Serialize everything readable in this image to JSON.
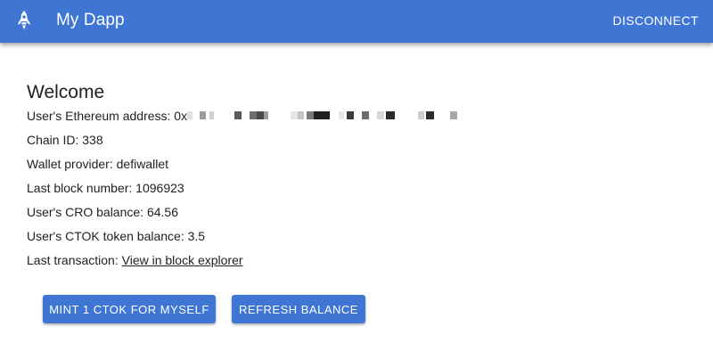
{
  "header": {
    "title": "My Dapp",
    "disconnect_label": "DISCONNECT",
    "logo_icon": "rocket-icon",
    "color": "#3f76d4"
  },
  "main": {
    "welcome": "Welcome",
    "address_label": "User's Ethereum address: 0x",
    "chain_id": "Chain ID: 338",
    "wallet_provider": "Wallet provider: defiwallet",
    "last_block": "Last block number: 1096923",
    "cro_balance": "User's CRO balance: 64.56",
    "ctok_balance": "User's CTOK token balance: 3.5",
    "last_tx_label": "Last transaction: ",
    "last_tx_link": "View in block explorer"
  },
  "actions": {
    "mint_label": "MINT 1 CTOK FOR MYSELF",
    "refresh_label": "REFRESH BALANCE"
  }
}
